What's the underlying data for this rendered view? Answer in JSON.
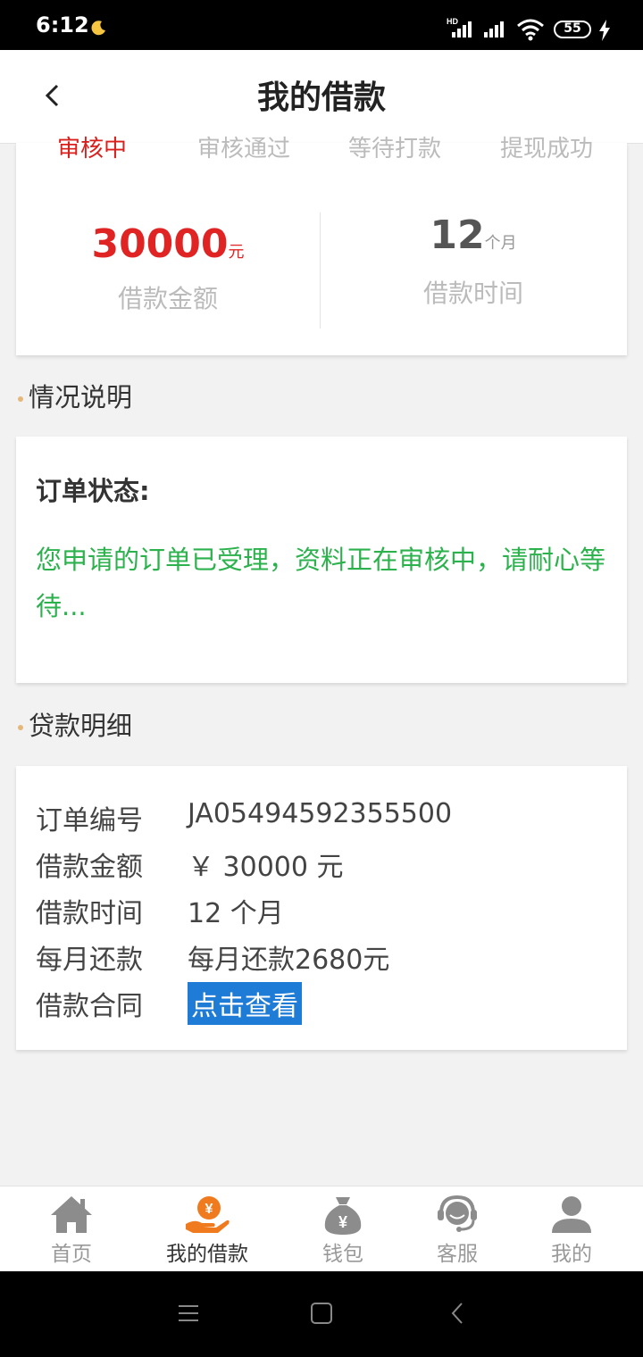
{
  "status_bar": {
    "time": "6:12",
    "battery": "55"
  },
  "header": {
    "title": "我的借款"
  },
  "steps": [
    "审核中",
    "审核通过",
    "等待打款",
    "提现成功"
  ],
  "summary": {
    "amount_value": "30000",
    "amount_unit": "元",
    "amount_label": "借款金额",
    "term_value": "12",
    "term_unit": "个月",
    "term_label": "借款时间"
  },
  "sections": {
    "status": "情况说明",
    "detail": "贷款明细"
  },
  "status_card": {
    "heading": "订单状态:",
    "message": "您申请的订单已受理，资料正在审核中，请耐心等待..."
  },
  "details": {
    "order_no_label": "订单编号",
    "order_no": "JA05494592355500",
    "amount_label": "借款金额",
    "amount": "￥ 30000 元",
    "term_label": "借款时间",
    "term": "12 个月",
    "monthly_label": "每月还款",
    "monthly": "每月还款2680元",
    "contract_label": "借款合同",
    "contract_link": "点击查看"
  },
  "tabs": [
    {
      "label": "首页",
      "icon": "home-icon"
    },
    {
      "label": "我的借款",
      "icon": "loan-hand-icon"
    },
    {
      "label": "钱包",
      "icon": "money-bag-icon"
    },
    {
      "label": "客服",
      "icon": "customer-service-icon"
    },
    {
      "label": "我的",
      "icon": "user-icon"
    }
  ],
  "colors": {
    "accent_red": "#e02424",
    "status_green": "#2bb24c",
    "link_blue": "#1e7bd6",
    "active_tab_orange": "#f07a1e"
  }
}
